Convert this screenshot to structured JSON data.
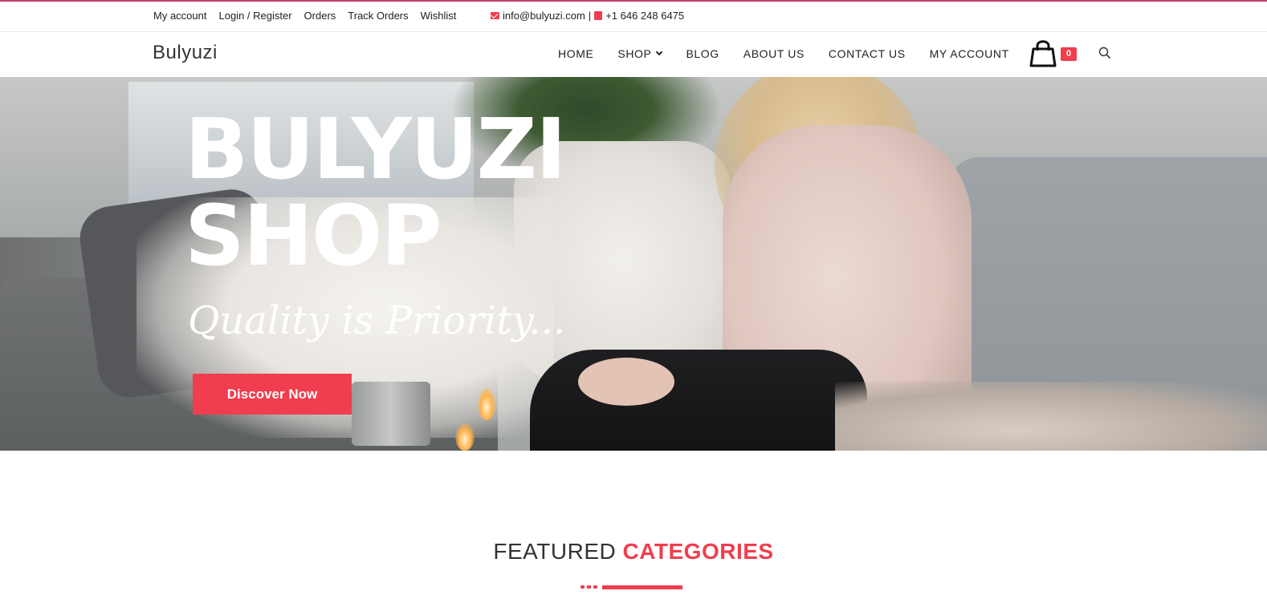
{
  "topbar": {
    "links": [
      "My account",
      "Login / Register",
      "Orders",
      "Track Orders",
      "Wishlist"
    ],
    "email": "info@bulyuzi.com",
    "separator": "|",
    "phone": "+1 646 248 6475"
  },
  "header": {
    "logo": "Bulyuzi",
    "nav": {
      "home": "HOME",
      "shop": "SHOP",
      "blog": "BLOG",
      "about": "ABOUT US",
      "contact": "CONTACT US",
      "account": "MY ACCOUNT"
    },
    "cart_count": "0"
  },
  "hero": {
    "title_line1": "BULYUZI",
    "title_line2": "SHOP",
    "subtitle": "Quality is Priority...",
    "button": "Discover Now"
  },
  "featured": {
    "word1": "FEATURED",
    "word2": "CATEGORIES"
  },
  "colors": {
    "accent": "#f03e4e",
    "top_border": "#c0426a"
  }
}
